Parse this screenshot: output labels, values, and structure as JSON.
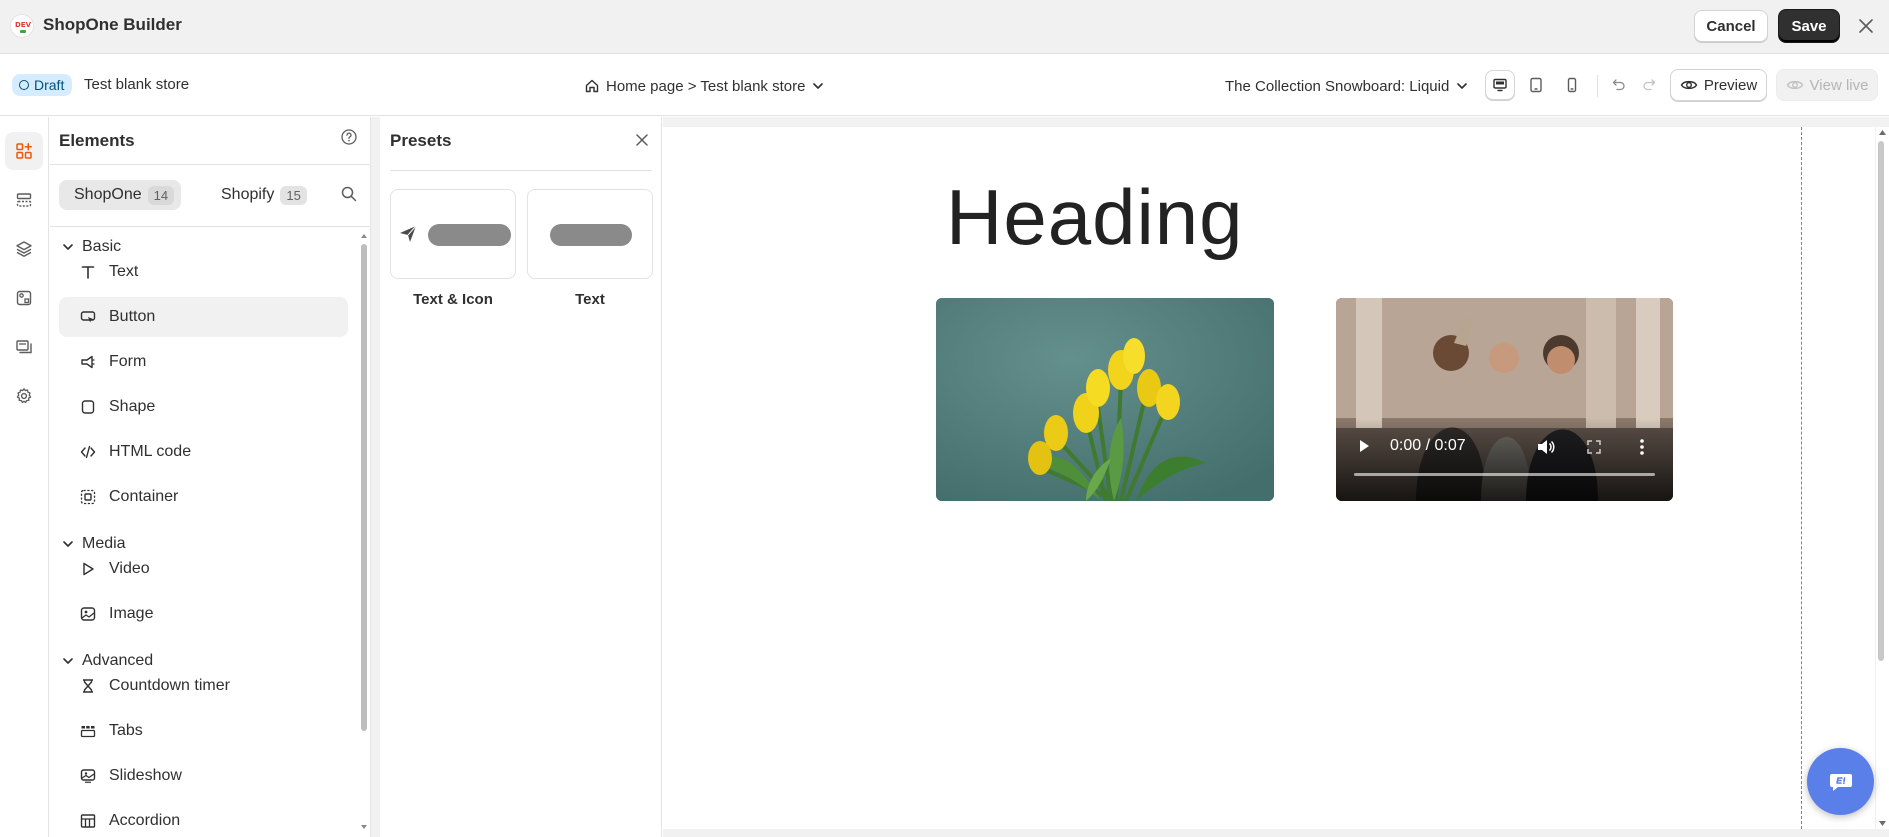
{
  "app": {
    "title": "ShopOne Builder",
    "logo_text": "DEV",
    "cancel_label": "Cancel",
    "save_label": "Save"
  },
  "subbar": {
    "status_badge": "Draft",
    "store_name": "Test blank store",
    "page_selector": "Home page > Test blank store",
    "template_selector": "The Collection Snowboard: Liquid",
    "preview_label": "Preview",
    "view_live_label": "View live"
  },
  "elements_panel": {
    "title": "Elements",
    "tabs": [
      {
        "label": "ShopOne",
        "count": "14",
        "active": true
      },
      {
        "label": "Shopify",
        "count": "15",
        "active": false
      }
    ],
    "groups": [
      {
        "label": "Basic",
        "items": [
          {
            "label": "Text",
            "icon": "text-icon"
          },
          {
            "label": "Button",
            "icon": "button-icon",
            "active": true
          },
          {
            "label": "Form",
            "icon": "form-icon"
          },
          {
            "label": "Shape",
            "icon": "shape-icon"
          },
          {
            "label": "HTML code",
            "icon": "code-icon"
          },
          {
            "label": "Container",
            "icon": "container-icon"
          }
        ]
      },
      {
        "label": "Media",
        "items": [
          {
            "label": "Video",
            "icon": "play-icon"
          },
          {
            "label": "Image",
            "icon": "image-icon"
          }
        ]
      },
      {
        "label": "Advanced",
        "items": [
          {
            "label": "Countdown timer",
            "icon": "hourglass-icon"
          },
          {
            "label": "Tabs",
            "icon": "tabs-icon"
          },
          {
            "label": "Slideshow",
            "icon": "slideshow-icon"
          },
          {
            "label": "Accordion",
            "icon": "accordion-icon"
          }
        ]
      }
    ]
  },
  "presets_panel": {
    "title": "Presets",
    "cards": [
      {
        "label": "Text & Icon"
      },
      {
        "label": "Text"
      }
    ]
  },
  "canvas": {
    "heading": "Heading",
    "video_time": "0:00 / 0:07"
  },
  "colors": {
    "accent_orange": "#e8590c",
    "draft_badge_bg": "#d5ebff",
    "save_bg": "#303030",
    "chat_fab": "#5b7fe8"
  }
}
